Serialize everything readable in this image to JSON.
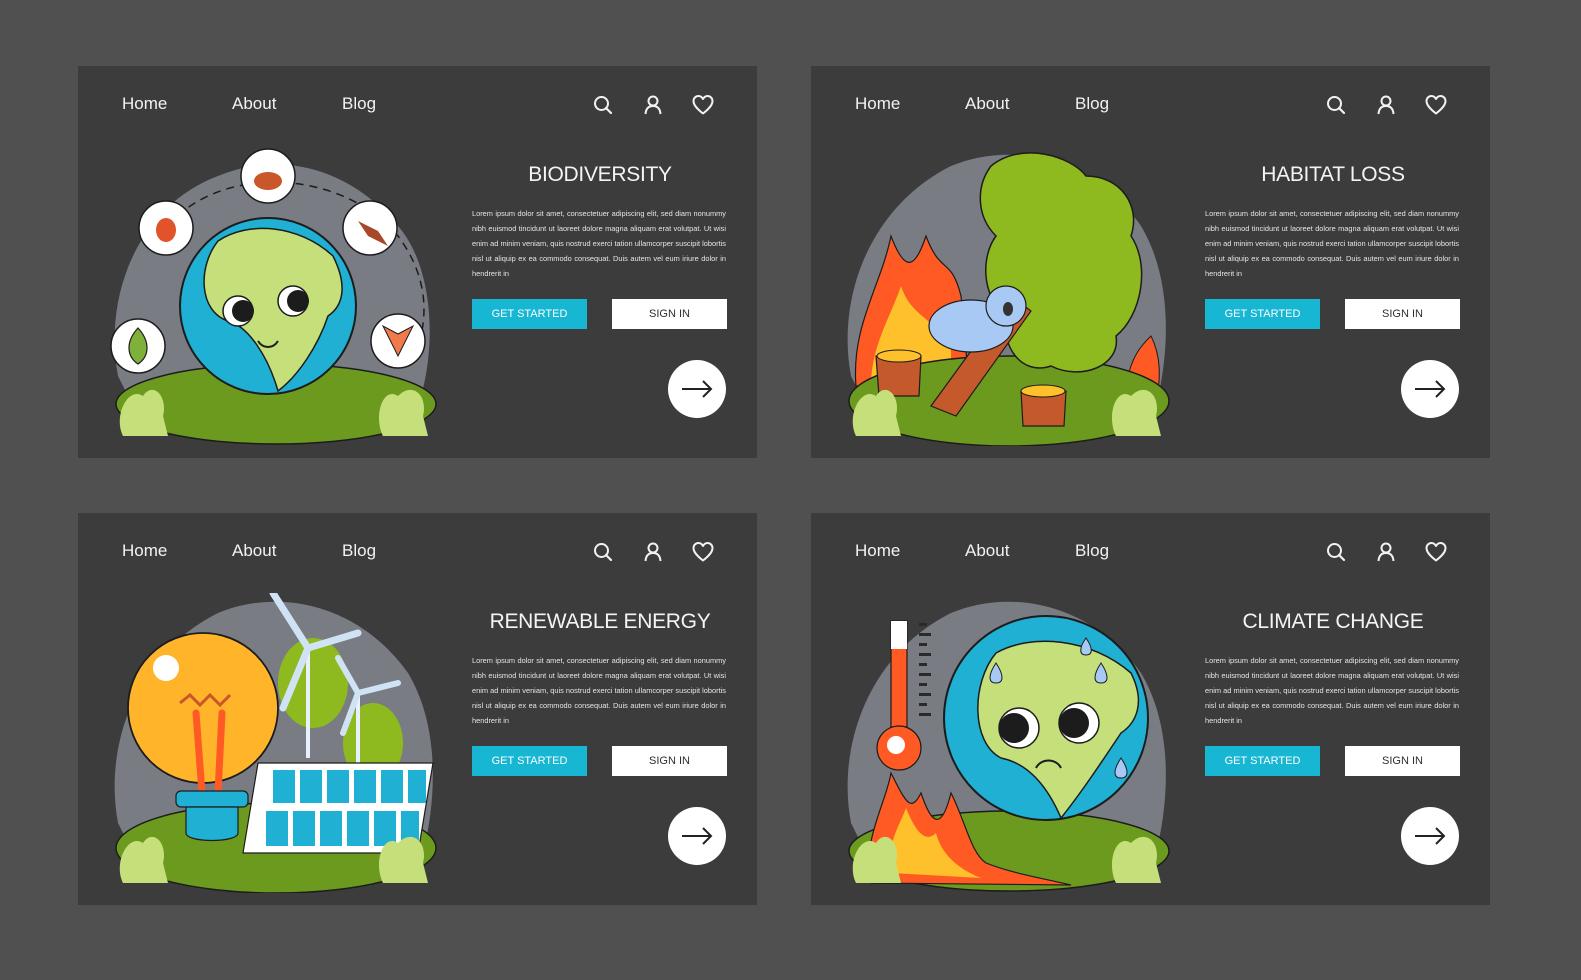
{
  "colors": {
    "page_background": "#505050",
    "card_background": "#3c3c3c",
    "accent_cyan": "#17b6d3",
    "button_white": "#ffffff"
  },
  "nav": {
    "items": [
      "Home",
      "About",
      "Blog"
    ],
    "icons": [
      "search-icon",
      "user-icon",
      "heart-icon"
    ]
  },
  "cards": [
    {
      "title": "BIODIVERSITY",
      "body": "Lorem ipsum dolor sit amet, consectetuer adipiscing elit, sed diam nonummy nibh euismod tincidunt ut laoreet dolore magna aliquam erat volutpat. Ut wisi enim ad minim veniam, quis nostrud exerci tation ullamcorper suscipit lobortis nisl ut aliquip ex ea commodo consequat. Duis autem vel eum iriure dolor in hendrerit in",
      "primary_button": "GET STARTED",
      "secondary_button": "SIGN IN",
      "arrow_icon": "arrow-right-icon",
      "illustration": "smiling-earth-with-species-icons"
    },
    {
      "title": "HABITAT LOSS",
      "body": "Lorem ipsum dolor sit amet, consectetuer adipiscing elit, sed diam nonummy nibh euismod tincidunt ut laoreet dolore magna aliquam erat volutpat. Ut wisi enim ad minim veniam, quis nostrud exerci tation ullamcorper suscipit lobortis nisl ut aliquip ex ea commodo consequat. Duis autem vel eum iriure dolor in hendrerit in",
      "primary_button": "GET STARTED",
      "secondary_button": "SIGN IN",
      "arrow_icon": "arrow-right-icon",
      "illustration": "koala-burning-forest-stumps"
    },
    {
      "title": "RENEWABLE ENERGY",
      "body": "Lorem ipsum dolor sit amet, consectetuer adipiscing elit, sed diam nonummy nibh euismod tincidunt ut laoreet dolore magna aliquam erat volutpat. Ut wisi enim ad minim veniam, quis nostrud exerci tation ullamcorper suscipit lobortis nisl ut aliquip ex ea commodo consequat. Duis autem vel eum iriure dolor in hendrerit in",
      "primary_button": "GET STARTED",
      "secondary_button": "SIGN IN",
      "arrow_icon": "arrow-right-icon",
      "illustration": "lightbulb-wind-turbines-solar-panel"
    },
    {
      "title": "CLIMATE CHANGE",
      "body": "Lorem ipsum dolor sit amet, consectetuer adipiscing elit, sed diam nonummy nibh euismod tincidunt ut laoreet dolore magna aliquam erat volutpat. Ut wisi enim ad minim veniam, quis nostrud exerci tation ullamcorper suscipit lobortis nisl ut aliquip ex ea commodo consequat. Duis autem vel eum iriure dolor in hendrerit in",
      "primary_button": "GET STARTED",
      "secondary_button": "SIGN IN",
      "arrow_icon": "arrow-right-icon",
      "illustration": "sweating-earth-thermometer-fire"
    }
  ]
}
